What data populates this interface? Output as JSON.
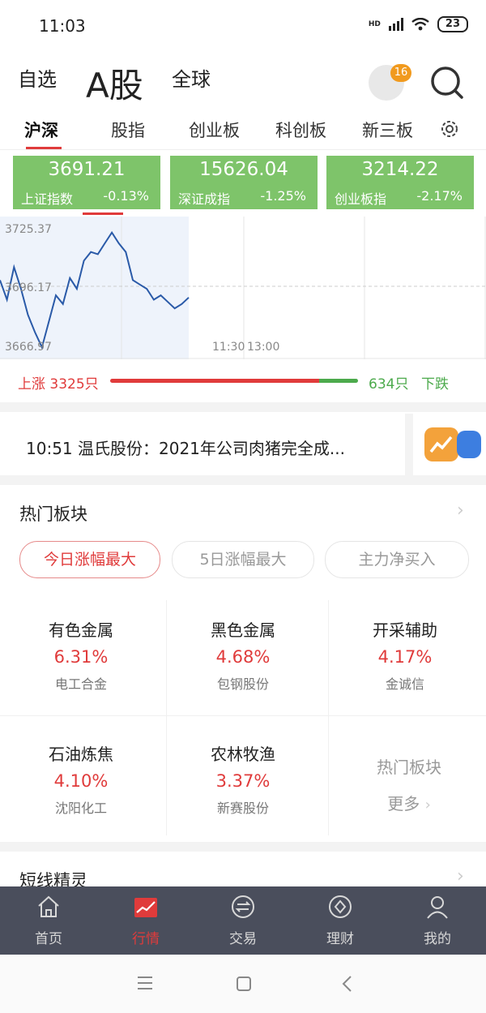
{
  "status_bar": {
    "time": "11:03",
    "hd": "HD",
    "battery": "23"
  },
  "top_nav": {
    "zixuan": "自选",
    "agu": "A股",
    "quanqiu": "全球",
    "avatar_badge": "16"
  },
  "tabs": [
    "沪深",
    "股指",
    "创业板",
    "科创板",
    "新三板"
  ],
  "index_cards": [
    {
      "value": "3691.21",
      "name": "上证指数",
      "change": "-0.13%"
    },
    {
      "value": "15626.04",
      "name": "深证成指",
      "change": "-1.25%"
    },
    {
      "value": "3214.22",
      "name": "创业板指",
      "change": "-2.17%"
    }
  ],
  "chart": {
    "y_labels": {
      "top": "3725.37",
      "mid": "3696.17",
      "bottom": "3666.97"
    },
    "x_labels": {
      "midday_end": "11:30",
      "afternoon_start": "13:00"
    },
    "line_color": "#2a5aa8"
  },
  "chart_data": {
    "type": "line",
    "title": "",
    "ylim": [
      3666.97,
      3725.37
    ],
    "x": [
      0,
      3,
      6,
      9,
      12,
      15,
      18,
      21,
      24,
      27,
      30,
      33,
      36,
      39,
      42,
      45,
      48,
      51,
      54,
      57,
      60,
      63,
      66,
      69,
      72,
      75,
      78,
      81
    ],
    "y": [
      3699,
      3690,
      3705,
      3695,
      3683,
      3675,
      3668,
      3680,
      3692,
      3688,
      3700,
      3695,
      3708,
      3712,
      3711,
      3716,
      3721,
      3716,
      3712,
      3699,
      3697,
      3695,
      3690,
      3692,
      3689,
      3686,
      3688,
      3691
    ],
    "xlabel": "",
    "ylabel": ""
  },
  "breadth": {
    "up_label": "上涨",
    "up_count": "3325只",
    "down_count": "634只",
    "down_label": "下跌",
    "up_ratio": 0.84
  },
  "news": {
    "text": "10:51 温氏股份：2021年公司肉猪完全成..."
  },
  "hot_sectors": {
    "title": "热门板块",
    "pills": [
      "今日涨幅最大",
      "5日涨幅最大",
      "主力净买入"
    ],
    "items": [
      {
        "name": "有色金属",
        "pct": "6.31%",
        "stock": "电工合金"
      },
      {
        "name": "黑色金属",
        "pct": "4.68%",
        "stock": "包钢股份"
      },
      {
        "name": "开采辅助",
        "pct": "4.17%",
        "stock": "金诚信"
      },
      {
        "name": "石油炼焦",
        "pct": "4.10%",
        "stock": "沈阳化工"
      },
      {
        "name": "农林牧渔",
        "pct": "3.37%",
        "stock": "新赛股份"
      }
    ],
    "more_title": "热门板块",
    "more_link": "更多"
  },
  "short_section": {
    "title": "短线精灵"
  },
  "bottom_nav": [
    "首页",
    "行情",
    "交易",
    "理财",
    "我的"
  ],
  "colors": {
    "up": "#e03b3b",
    "down": "#4caa4c",
    "card": "#7ec46a",
    "nav_bg": "#4a4e5c"
  }
}
